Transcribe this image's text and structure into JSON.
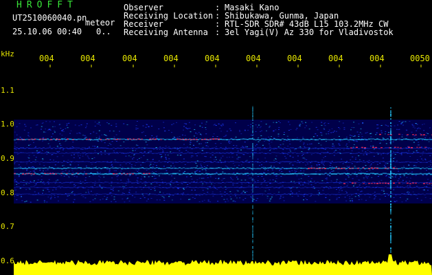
{
  "header": {
    "app_title": "HROFFT",
    "filename": "UT2510060040.pn",
    "mode": "meteor",
    "datetime": "25.10.06 00:40",
    "counter": "0..",
    "info": [
      {
        "label": "Observer",
        "value": "Masaki Kano"
      },
      {
        "label": "Receiving Location",
        "value": "Shibukawa, Gunma, Japan"
      },
      {
        "label": "Receiver",
        "value": "RTL-SDR SDR# 43dB L15 103.2MHz CW"
      },
      {
        "label": "Receiving Antenna",
        "value": "3el Yagi(V) Az 330 for Vladivostok"
      }
    ],
    "colon": ":"
  },
  "time_axis": {
    "ticks": [
      "004",
      "004",
      "004",
      "004",
      "004",
      "004",
      "004",
      "004",
      "004",
      "0050"
    ]
  },
  "freq_axis": {
    "unit": "kHz",
    "ticks": [
      "1.1",
      "1.0",
      "0.9",
      "0.8",
      "0.7",
      "0.6"
    ]
  },
  "colors": {
    "background": "#000000",
    "band": "#00006a",
    "signal_blue": "#1e3cff",
    "signal_cyan": "#22c8ff",
    "signal_red": "#ff2a55",
    "power_trace": "#ffff00",
    "text_green": "#39e639",
    "text_yellow": "#e6e600"
  }
}
